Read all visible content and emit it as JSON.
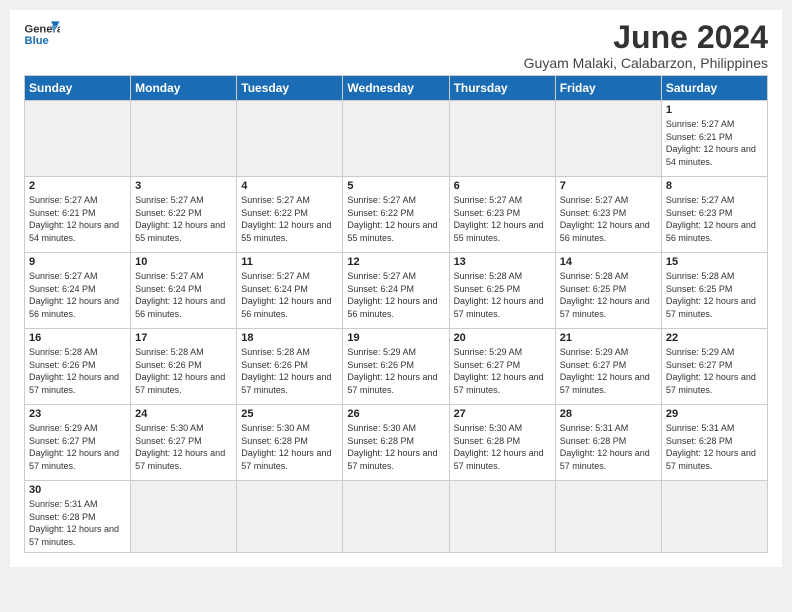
{
  "header": {
    "logo_text_normal": "General",
    "logo_text_blue": "Blue",
    "month_title": "June 2024",
    "subtitle": "Guyam Malaki, Calabarzon, Philippines"
  },
  "days_of_week": [
    "Sunday",
    "Monday",
    "Tuesday",
    "Wednesday",
    "Thursday",
    "Friday",
    "Saturday"
  ],
  "weeks": [
    [
      {
        "day": "",
        "empty": true
      },
      {
        "day": "",
        "empty": true
      },
      {
        "day": "",
        "empty": true
      },
      {
        "day": "",
        "empty": true
      },
      {
        "day": "",
        "empty": true
      },
      {
        "day": "",
        "empty": true
      },
      {
        "day": "1",
        "sunrise": "5:27 AM",
        "sunset": "6:21 PM",
        "daylight": "12 hours and 54 minutes."
      }
    ],
    [
      {
        "day": "2",
        "sunrise": "5:27 AM",
        "sunset": "6:21 PM",
        "daylight": "12 hours and 54 minutes."
      },
      {
        "day": "3",
        "sunrise": "5:27 AM",
        "sunset": "6:22 PM",
        "daylight": "12 hours and 55 minutes."
      },
      {
        "day": "4",
        "sunrise": "5:27 AM",
        "sunset": "6:22 PM",
        "daylight": "12 hours and 55 minutes."
      },
      {
        "day": "5",
        "sunrise": "5:27 AM",
        "sunset": "6:22 PM",
        "daylight": "12 hours and 55 minutes."
      },
      {
        "day": "6",
        "sunrise": "5:27 AM",
        "sunset": "6:23 PM",
        "daylight": "12 hours and 55 minutes."
      },
      {
        "day": "7",
        "sunrise": "5:27 AM",
        "sunset": "6:23 PM",
        "daylight": "12 hours and 56 minutes."
      },
      {
        "day": "8",
        "sunrise": "5:27 AM",
        "sunset": "6:23 PM",
        "daylight": "12 hours and 56 minutes."
      }
    ],
    [
      {
        "day": "9",
        "sunrise": "5:27 AM",
        "sunset": "6:24 PM",
        "daylight": "12 hours and 56 minutes."
      },
      {
        "day": "10",
        "sunrise": "5:27 AM",
        "sunset": "6:24 PM",
        "daylight": "12 hours and 56 minutes."
      },
      {
        "day": "11",
        "sunrise": "5:27 AM",
        "sunset": "6:24 PM",
        "daylight": "12 hours and 56 minutes."
      },
      {
        "day": "12",
        "sunrise": "5:27 AM",
        "sunset": "6:24 PM",
        "daylight": "12 hours and 56 minutes."
      },
      {
        "day": "13",
        "sunrise": "5:28 AM",
        "sunset": "6:25 PM",
        "daylight": "12 hours and 57 minutes."
      },
      {
        "day": "14",
        "sunrise": "5:28 AM",
        "sunset": "6:25 PM",
        "daylight": "12 hours and 57 minutes."
      },
      {
        "day": "15",
        "sunrise": "5:28 AM",
        "sunset": "6:25 PM",
        "daylight": "12 hours and 57 minutes."
      }
    ],
    [
      {
        "day": "16",
        "sunrise": "5:28 AM",
        "sunset": "6:26 PM",
        "daylight": "12 hours and 57 minutes."
      },
      {
        "day": "17",
        "sunrise": "5:28 AM",
        "sunset": "6:26 PM",
        "daylight": "12 hours and 57 minutes."
      },
      {
        "day": "18",
        "sunrise": "5:28 AM",
        "sunset": "6:26 PM",
        "daylight": "12 hours and 57 minutes."
      },
      {
        "day": "19",
        "sunrise": "5:29 AM",
        "sunset": "6:26 PM",
        "daylight": "12 hours and 57 minutes."
      },
      {
        "day": "20",
        "sunrise": "5:29 AM",
        "sunset": "6:27 PM",
        "daylight": "12 hours and 57 minutes."
      },
      {
        "day": "21",
        "sunrise": "5:29 AM",
        "sunset": "6:27 PM",
        "daylight": "12 hours and 57 minutes."
      },
      {
        "day": "22",
        "sunrise": "5:29 AM",
        "sunset": "6:27 PM",
        "daylight": "12 hours and 57 minutes."
      }
    ],
    [
      {
        "day": "23",
        "sunrise": "5:29 AM",
        "sunset": "6:27 PM",
        "daylight": "12 hours and 57 minutes."
      },
      {
        "day": "24",
        "sunrise": "5:30 AM",
        "sunset": "6:27 PM",
        "daylight": "12 hours and 57 minutes."
      },
      {
        "day": "25",
        "sunrise": "5:30 AM",
        "sunset": "6:28 PM",
        "daylight": "12 hours and 57 minutes."
      },
      {
        "day": "26",
        "sunrise": "5:30 AM",
        "sunset": "6:28 PM",
        "daylight": "12 hours and 57 minutes."
      },
      {
        "day": "27",
        "sunrise": "5:30 AM",
        "sunset": "6:28 PM",
        "daylight": "12 hours and 57 minutes."
      },
      {
        "day": "28",
        "sunrise": "5:31 AM",
        "sunset": "6:28 PM",
        "daylight": "12 hours and 57 minutes."
      },
      {
        "day": "29",
        "sunrise": "5:31 AM",
        "sunset": "6:28 PM",
        "daylight": "12 hours and 57 minutes."
      }
    ],
    [
      {
        "day": "30",
        "sunrise": "5:31 AM",
        "sunset": "6:28 PM",
        "daylight": "12 hours and 57 minutes."
      },
      {
        "day": "",
        "empty": true
      },
      {
        "day": "",
        "empty": true
      },
      {
        "day": "",
        "empty": true
      },
      {
        "day": "",
        "empty": true
      },
      {
        "day": "",
        "empty": true
      },
      {
        "day": "",
        "empty": true
      }
    ]
  ]
}
